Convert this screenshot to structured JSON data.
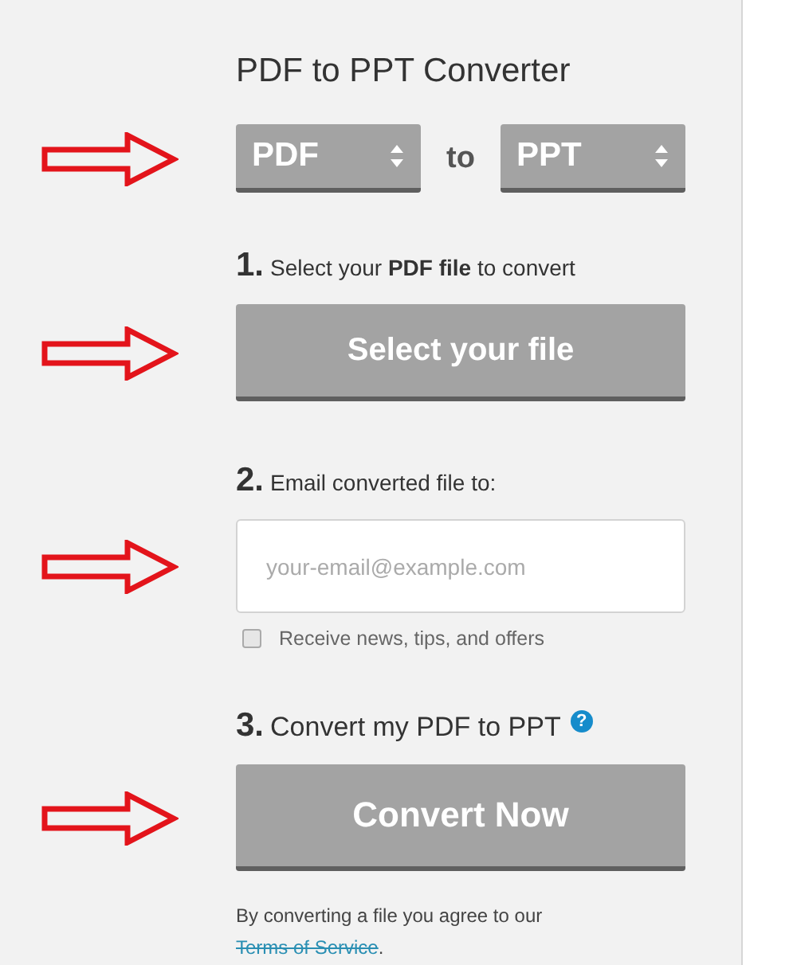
{
  "title": "PDF to PPT Converter",
  "format_row": {
    "annotated": true,
    "from": {
      "value": "PDF"
    },
    "separator": "to",
    "to": {
      "value": "PPT"
    }
  },
  "step_1": {
    "number": "1.",
    "label": "Select your **PDF file** to convert",
    "button": "Select your file",
    "annotated": true
  },
  "step_2": {
    "number": "2.",
    "label": "Email converted file to:",
    "email": {
      "placeholder": "your-email@example.com",
      "annotated": true
    },
    "newsletter": {
      "label": "Receive news, tips, and offers",
      "checked": false
    }
  },
  "step_3": {
    "number": "3.",
    "label": "Convert my PDF to PPT",
    "help": "?",
    "button": "Convert Now",
    "annotated": true
  },
  "footer": {
    "text": "By converting a file you agree to our",
    "link": "Terms of Service",
    "end": "."
  }
}
